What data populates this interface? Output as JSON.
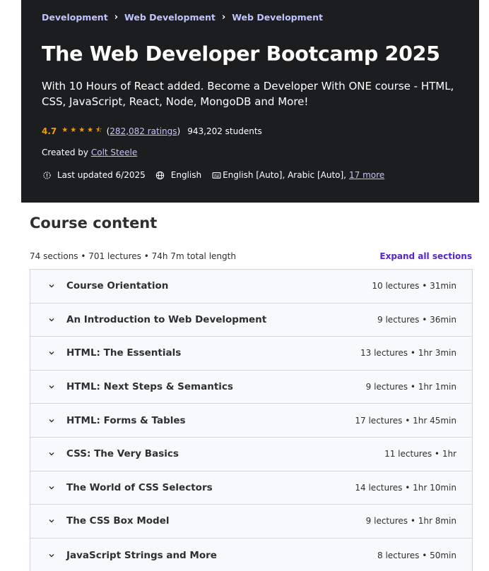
{
  "breadcrumb": [
    "Development",
    "Web Development",
    "Web Development"
  ],
  "course": {
    "title": "The Web Developer Bootcamp 2025",
    "subtitle": "With 10 Hours of React added. Become a Developer With ONE course - HTML, CSS, JavaScript, React, Node, MongoDB and More!",
    "rating": "4.7",
    "stars": "★★★★⯪",
    "ratings_link": "282,082 ratings",
    "open_paren": "(",
    "close_paren": ")",
    "students": "943,202 students",
    "created_by_label": "Created by",
    "instructor": "Colt Steele",
    "last_updated": "Last updated 6/2025",
    "language": "English",
    "captions": "English [Auto], Arabic [Auto],",
    "more_captions": "17 more"
  },
  "content": {
    "heading": "Course content",
    "summary": "74 sections • 701 lectures • 74h 7m total length",
    "expand_label": "Expand all sections",
    "sections": [
      {
        "title": "Course Orientation",
        "meta": "10 lectures • 31min"
      },
      {
        "title": "An Introduction to Web Development",
        "meta": "9 lectures • 36min"
      },
      {
        "title": "HTML: The Essentials",
        "meta": "13 lectures • 1hr 3min"
      },
      {
        "title": "HTML: Next Steps & Semantics",
        "meta": "9 lectures • 1hr 1min"
      },
      {
        "title": "HTML: Forms & Tables",
        "meta": "17 lectures • 1hr 45min"
      },
      {
        "title": "CSS: The Very Basics",
        "meta": "11 lectures • 1hr"
      },
      {
        "title": "The World of CSS Selectors",
        "meta": "14 lectures • 1hr 10min"
      },
      {
        "title": "The CSS Box Model",
        "meta": "9 lectures • 1hr 8min"
      },
      {
        "title": "JavaScript Strings and More",
        "meta": "8 lectures • 50min"
      }
    ]
  },
  "icons": {
    "breadcrumb_separator": "chevron-right-icon",
    "updated": "alert-badge-icon",
    "language": "globe-icon",
    "captions": "closed-captions-icon",
    "section": "chevron-down-icon"
  },
  "colors": {
    "hero_bg": "#1c1d1f",
    "link": "#c0c4fc",
    "star": "#f69c08",
    "accent": "#5624d0",
    "row_bg": "#f7f9fa",
    "border": "#d1d7dc"
  }
}
